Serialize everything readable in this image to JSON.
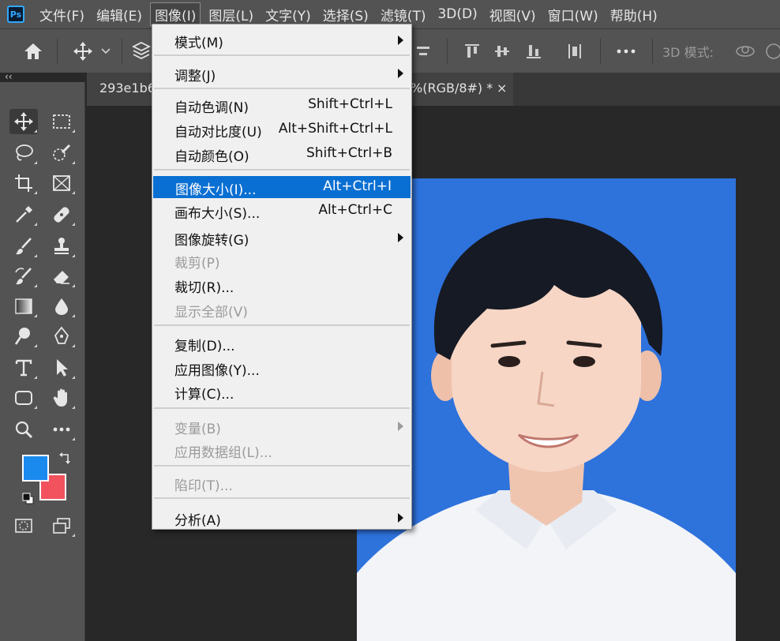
{
  "app": {
    "logo": "Ps"
  },
  "menubar": {
    "items": [
      "文件(F)",
      "编辑(E)",
      "图像(I)",
      "图层(L)",
      "文字(Y)",
      "选择(S)",
      "滤镜(T)",
      "3D(D)",
      "视图(V)",
      "窗口(W)",
      "帮助(H)"
    ],
    "active_index": 2
  },
  "options": {
    "mode_label": "3D 模式:"
  },
  "panel": {
    "collapse_glyph": "‹‹"
  },
  "document": {
    "tab_left": "293e1b6",
    "tab_right": "%(RGB/8#) *",
    "close_glyph": "×"
  },
  "colors": {
    "foreground": "#1b8aef",
    "background": "#f1525d",
    "highlight": "#0a6fd2",
    "photo_bg": "#2e72dc"
  },
  "image_menu": {
    "mode": {
      "label": "模式(M)"
    },
    "adjust": {
      "label": "调整(J)"
    },
    "auto_tone": {
      "label": "自动色调(N)",
      "shortcut": "Shift+Ctrl+L"
    },
    "auto_contrast": {
      "label": "自动对比度(U)",
      "shortcut": "Alt+Shift+Ctrl+L"
    },
    "auto_color": {
      "label": "自动颜色(O)",
      "shortcut": "Shift+Ctrl+B"
    },
    "image_size": {
      "label": "图像大小(I)...",
      "shortcut": "Alt+Ctrl+I"
    },
    "canvas_size": {
      "label": "画布大小(S)...",
      "shortcut": "Alt+Ctrl+C"
    },
    "image_rotation": {
      "label": "图像旋转(G)"
    },
    "crop": {
      "label": "裁剪(P)"
    },
    "trim": {
      "label": "裁切(R)..."
    },
    "reveal_all": {
      "label": "显示全部(V)"
    },
    "duplicate": {
      "label": "复制(D)..."
    },
    "apply_image": {
      "label": "应用图像(Y)..."
    },
    "calculations": {
      "label": "计算(C)..."
    },
    "variables": {
      "label": "变量(B)"
    },
    "apply_data_set": {
      "label": "应用数据组(L)..."
    },
    "trap": {
      "label": "陷印(T)..."
    },
    "analysis": {
      "label": "分析(A)"
    }
  }
}
